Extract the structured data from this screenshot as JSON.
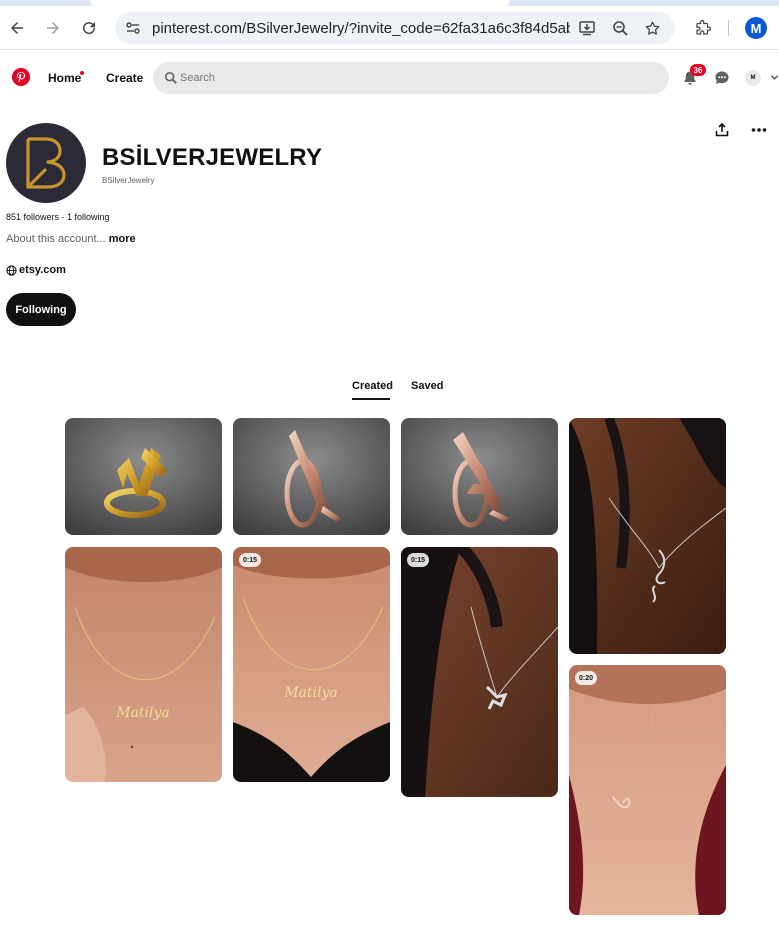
{
  "browser": {
    "url": "pinterest.com/BSilverJewelry/?invite_code=62fa31a6c3f84d5abbe...",
    "profile_initial": "M",
    "icons": [
      "back-arrow-icon",
      "forward-arrow-icon",
      "reload-icon",
      "site-info-icon",
      "install-app-icon",
      "zoom-icon",
      "bookmark-star-icon",
      "extensions-icon"
    ]
  },
  "header": {
    "home_label": "Home",
    "create_label": "Create",
    "search_placeholder": "Search",
    "notifications_count": "36",
    "user_initial": "M"
  },
  "profile": {
    "name": "BSİLVERJEWELRY",
    "handle": "BSilverJewelry",
    "stats": "851 followers · 1 following",
    "about": "About this account...",
    "about_more": "more",
    "website": "etsy.com",
    "following_label": "Following",
    "accent_color": "#c7962f"
  },
  "tabs": {
    "created": "Created",
    "saved": "Saved"
  },
  "pins": [
    {
      "kind": "gold-letter-ring"
    },
    {
      "kind": "rose-letter-ring-i"
    },
    {
      "kind": "rose-letter-ring-a"
    },
    {
      "kind": "necklace-dark-skin"
    },
    {
      "kind": "name-necklace-gold"
    },
    {
      "kind": "name-necklace-video",
      "duration": "0:15"
    },
    {
      "kind": "pendant-necklace-video",
      "duration": "0:15"
    },
    {
      "kind": "name-necklace-rose-video",
      "duration": "0:20"
    }
  ]
}
